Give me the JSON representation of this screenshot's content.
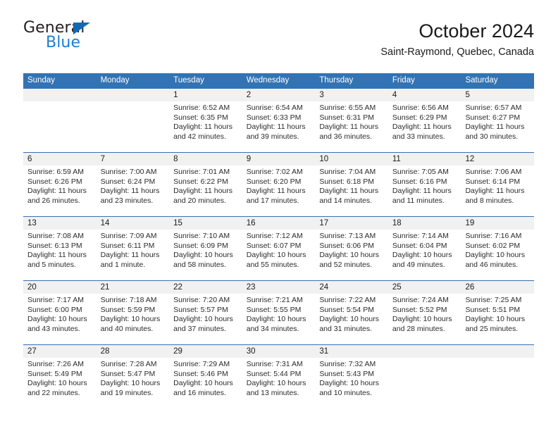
{
  "brand": {
    "name_part1": "General",
    "name_part2": "Blue",
    "triangle_color": "#1268b3",
    "blue_color": "#1b7fd4"
  },
  "header": {
    "title": "October 2024",
    "subtitle": "Saint-Raymond, Quebec, Canada"
  },
  "theme": {
    "header_blue": "#3273b4",
    "daynum_band": "#f1f1f1",
    "text": "#1a1a1a"
  },
  "weekdays": [
    "Sunday",
    "Monday",
    "Tuesday",
    "Wednesday",
    "Thursday",
    "Friday",
    "Saturday"
  ],
  "weeks": [
    [
      {
        "day": "",
        "sunrise": "",
        "sunset": "",
        "daylight1": "",
        "daylight2": ""
      },
      {
        "day": "",
        "sunrise": "",
        "sunset": "",
        "daylight1": "",
        "daylight2": ""
      },
      {
        "day": "1",
        "sunrise": "Sunrise: 6:52 AM",
        "sunset": "Sunset: 6:35 PM",
        "daylight1": "Daylight: 11 hours",
        "daylight2": "and 42 minutes."
      },
      {
        "day": "2",
        "sunrise": "Sunrise: 6:54 AM",
        "sunset": "Sunset: 6:33 PM",
        "daylight1": "Daylight: 11 hours",
        "daylight2": "and 39 minutes."
      },
      {
        "day": "3",
        "sunrise": "Sunrise: 6:55 AM",
        "sunset": "Sunset: 6:31 PM",
        "daylight1": "Daylight: 11 hours",
        "daylight2": "and 36 minutes."
      },
      {
        "day": "4",
        "sunrise": "Sunrise: 6:56 AM",
        "sunset": "Sunset: 6:29 PM",
        "daylight1": "Daylight: 11 hours",
        "daylight2": "and 33 minutes."
      },
      {
        "day": "5",
        "sunrise": "Sunrise: 6:57 AM",
        "sunset": "Sunset: 6:27 PM",
        "daylight1": "Daylight: 11 hours",
        "daylight2": "and 30 minutes."
      }
    ],
    [
      {
        "day": "6",
        "sunrise": "Sunrise: 6:59 AM",
        "sunset": "Sunset: 6:26 PM",
        "daylight1": "Daylight: 11 hours",
        "daylight2": "and 26 minutes."
      },
      {
        "day": "7",
        "sunrise": "Sunrise: 7:00 AM",
        "sunset": "Sunset: 6:24 PM",
        "daylight1": "Daylight: 11 hours",
        "daylight2": "and 23 minutes."
      },
      {
        "day": "8",
        "sunrise": "Sunrise: 7:01 AM",
        "sunset": "Sunset: 6:22 PM",
        "daylight1": "Daylight: 11 hours",
        "daylight2": "and 20 minutes."
      },
      {
        "day": "9",
        "sunrise": "Sunrise: 7:02 AM",
        "sunset": "Sunset: 6:20 PM",
        "daylight1": "Daylight: 11 hours",
        "daylight2": "and 17 minutes."
      },
      {
        "day": "10",
        "sunrise": "Sunrise: 7:04 AM",
        "sunset": "Sunset: 6:18 PM",
        "daylight1": "Daylight: 11 hours",
        "daylight2": "and 14 minutes."
      },
      {
        "day": "11",
        "sunrise": "Sunrise: 7:05 AM",
        "sunset": "Sunset: 6:16 PM",
        "daylight1": "Daylight: 11 hours",
        "daylight2": "and 11 minutes."
      },
      {
        "day": "12",
        "sunrise": "Sunrise: 7:06 AM",
        "sunset": "Sunset: 6:14 PM",
        "daylight1": "Daylight: 11 hours",
        "daylight2": "and 8 minutes."
      }
    ],
    [
      {
        "day": "13",
        "sunrise": "Sunrise: 7:08 AM",
        "sunset": "Sunset: 6:13 PM",
        "daylight1": "Daylight: 11 hours",
        "daylight2": "and 5 minutes."
      },
      {
        "day": "14",
        "sunrise": "Sunrise: 7:09 AM",
        "sunset": "Sunset: 6:11 PM",
        "daylight1": "Daylight: 11 hours",
        "daylight2": "and 1 minute."
      },
      {
        "day": "15",
        "sunrise": "Sunrise: 7:10 AM",
        "sunset": "Sunset: 6:09 PM",
        "daylight1": "Daylight: 10 hours",
        "daylight2": "and 58 minutes."
      },
      {
        "day": "16",
        "sunrise": "Sunrise: 7:12 AM",
        "sunset": "Sunset: 6:07 PM",
        "daylight1": "Daylight: 10 hours",
        "daylight2": "and 55 minutes."
      },
      {
        "day": "17",
        "sunrise": "Sunrise: 7:13 AM",
        "sunset": "Sunset: 6:06 PM",
        "daylight1": "Daylight: 10 hours",
        "daylight2": "and 52 minutes."
      },
      {
        "day": "18",
        "sunrise": "Sunrise: 7:14 AM",
        "sunset": "Sunset: 6:04 PM",
        "daylight1": "Daylight: 10 hours",
        "daylight2": "and 49 minutes."
      },
      {
        "day": "19",
        "sunrise": "Sunrise: 7:16 AM",
        "sunset": "Sunset: 6:02 PM",
        "daylight1": "Daylight: 10 hours",
        "daylight2": "and 46 minutes."
      }
    ],
    [
      {
        "day": "20",
        "sunrise": "Sunrise: 7:17 AM",
        "sunset": "Sunset: 6:00 PM",
        "daylight1": "Daylight: 10 hours",
        "daylight2": "and 43 minutes."
      },
      {
        "day": "21",
        "sunrise": "Sunrise: 7:18 AM",
        "sunset": "Sunset: 5:59 PM",
        "daylight1": "Daylight: 10 hours",
        "daylight2": "and 40 minutes."
      },
      {
        "day": "22",
        "sunrise": "Sunrise: 7:20 AM",
        "sunset": "Sunset: 5:57 PM",
        "daylight1": "Daylight: 10 hours",
        "daylight2": "and 37 minutes."
      },
      {
        "day": "23",
        "sunrise": "Sunrise: 7:21 AM",
        "sunset": "Sunset: 5:55 PM",
        "daylight1": "Daylight: 10 hours",
        "daylight2": "and 34 minutes."
      },
      {
        "day": "24",
        "sunrise": "Sunrise: 7:22 AM",
        "sunset": "Sunset: 5:54 PM",
        "daylight1": "Daylight: 10 hours",
        "daylight2": "and 31 minutes."
      },
      {
        "day": "25",
        "sunrise": "Sunrise: 7:24 AM",
        "sunset": "Sunset: 5:52 PM",
        "daylight1": "Daylight: 10 hours",
        "daylight2": "and 28 minutes."
      },
      {
        "day": "26",
        "sunrise": "Sunrise: 7:25 AM",
        "sunset": "Sunset: 5:51 PM",
        "daylight1": "Daylight: 10 hours",
        "daylight2": "and 25 minutes."
      }
    ],
    [
      {
        "day": "27",
        "sunrise": "Sunrise: 7:26 AM",
        "sunset": "Sunset: 5:49 PM",
        "daylight1": "Daylight: 10 hours",
        "daylight2": "and 22 minutes."
      },
      {
        "day": "28",
        "sunrise": "Sunrise: 7:28 AM",
        "sunset": "Sunset: 5:47 PM",
        "daylight1": "Daylight: 10 hours",
        "daylight2": "and 19 minutes."
      },
      {
        "day": "29",
        "sunrise": "Sunrise: 7:29 AM",
        "sunset": "Sunset: 5:46 PM",
        "daylight1": "Daylight: 10 hours",
        "daylight2": "and 16 minutes."
      },
      {
        "day": "30",
        "sunrise": "Sunrise: 7:31 AM",
        "sunset": "Sunset: 5:44 PM",
        "daylight1": "Daylight: 10 hours",
        "daylight2": "and 13 minutes."
      },
      {
        "day": "31",
        "sunrise": "Sunrise: 7:32 AM",
        "sunset": "Sunset: 5:43 PM",
        "daylight1": "Daylight: 10 hours",
        "daylight2": "and 10 minutes."
      },
      {
        "day": "",
        "sunrise": "",
        "sunset": "",
        "daylight1": "",
        "daylight2": ""
      },
      {
        "day": "",
        "sunrise": "",
        "sunset": "",
        "daylight1": "",
        "daylight2": ""
      }
    ]
  ]
}
